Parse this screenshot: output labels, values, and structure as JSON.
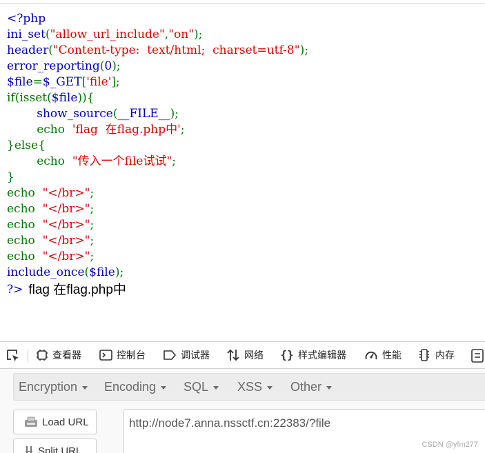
{
  "source": {
    "lines": [
      [
        {
          "c": "df",
          "t": "<?php"
        }
      ],
      [
        {
          "c": "df",
          "t": "ini_set"
        },
        {
          "c": "kw",
          "t": "("
        },
        {
          "c": "st",
          "t": "\"allow_url_include\""
        },
        {
          "c": "kw",
          "t": ","
        },
        {
          "c": "st",
          "t": "\"on\""
        },
        {
          "c": "kw",
          "t": ");"
        }
      ],
      [
        {
          "c": "df",
          "t": "header"
        },
        {
          "c": "kw",
          "t": "("
        },
        {
          "c": "st",
          "t": "\"Content-type:  text/html;  charset=utf-8\""
        },
        {
          "c": "kw",
          "t": ");"
        }
      ],
      [
        {
          "c": "df",
          "t": "error_reporting"
        },
        {
          "c": "kw",
          "t": "("
        },
        {
          "c": "df",
          "t": "0"
        },
        {
          "c": "kw",
          "t": ");"
        }
      ],
      [
        {
          "c": "df",
          "t": "$file"
        },
        {
          "c": "kw",
          "t": "="
        },
        {
          "c": "df",
          "t": "$_GET"
        },
        {
          "c": "kw",
          "t": "["
        },
        {
          "c": "st",
          "t": "'file'"
        },
        {
          "c": "kw",
          "t": "];"
        }
      ],
      [
        {
          "c": "kw",
          "t": "if(isset("
        },
        {
          "c": "df",
          "t": "$file"
        },
        {
          "c": "kw",
          "t": ")){"
        }
      ],
      [
        {
          "c": "kw",
          "t": "        "
        },
        {
          "c": "df",
          "t": "show_source"
        },
        {
          "c": "kw",
          "t": "("
        },
        {
          "c": "df",
          "t": "__FILE__"
        },
        {
          "c": "kw",
          "t": ");"
        }
      ],
      [
        {
          "c": "kw",
          "t": "        echo  "
        },
        {
          "c": "st",
          "t": "'flag  在flag.php中'"
        },
        {
          "c": "kw",
          "t": ";"
        }
      ],
      [
        {
          "c": "kw",
          "t": "}else{"
        }
      ],
      [
        {
          "c": "kw",
          "t": "        echo  "
        },
        {
          "c": "st",
          "t": "\"传入一个file试试\""
        },
        {
          "c": "kw",
          "t": ";"
        }
      ],
      [
        {
          "c": "kw",
          "t": "}"
        }
      ],
      [
        {
          "c": "kw",
          "t": "echo  "
        },
        {
          "c": "st",
          "t": "\"</br>\""
        },
        {
          "c": "kw",
          "t": ";"
        }
      ],
      [
        {
          "c": "kw",
          "t": "echo  "
        },
        {
          "c": "st",
          "t": "\"</br>\""
        },
        {
          "c": "kw",
          "t": ";"
        }
      ],
      [
        {
          "c": "kw",
          "t": "echo  "
        },
        {
          "c": "st",
          "t": "\"</br>\""
        },
        {
          "c": "kw",
          "t": ";"
        }
      ],
      [
        {
          "c": "kw",
          "t": "echo  "
        },
        {
          "c": "st",
          "t": "\"</br>\""
        },
        {
          "c": "kw",
          "t": ";"
        }
      ],
      [
        {
          "c": "kw",
          "t": "echo  "
        },
        {
          "c": "st",
          "t": "\"</br>\""
        },
        {
          "c": "kw",
          "t": ";"
        }
      ],
      [
        {
          "c": "df",
          "t": "include_once"
        },
        {
          "c": "kw",
          "t": "("
        },
        {
          "c": "df",
          "t": "$file"
        },
        {
          "c": "kw",
          "t": ");"
        }
      ]
    ],
    "closing_tag": "?>",
    "output_text": "flag 在flag.php中"
  },
  "devtools": {
    "tabs": [
      {
        "label": "查看器",
        "icon": "inspector-icon"
      },
      {
        "label": "控制台",
        "icon": "console-icon"
      },
      {
        "label": "调试器",
        "icon": "debugger-icon"
      },
      {
        "label": "网络",
        "icon": "network-icon"
      },
      {
        "label": "样式编辑器",
        "icon": "style-editor-icon"
      },
      {
        "label": "性能",
        "icon": "performance-icon"
      },
      {
        "label": "内存",
        "icon": "memory-icon"
      }
    ]
  },
  "hackbar": {
    "menu": [
      "Encryption",
      "Encoding",
      "SQL",
      "XSS",
      "Other"
    ],
    "load_url_label": "Load URL",
    "split_url_label": "Split URL",
    "url_value": "http://node7.anna.nssctf.cn:22383/?file"
  },
  "watermark": "CSDN @yfm277",
  "colors": {
    "php_default": "#0000bb",
    "php_keyword": "#007700",
    "php_string": "#dd0000"
  }
}
